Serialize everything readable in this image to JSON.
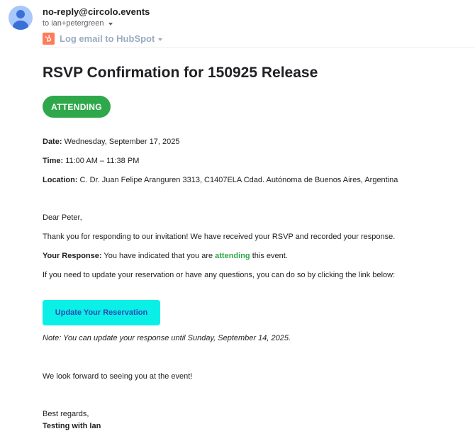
{
  "header": {
    "sender": "no-reply@circolo.events",
    "recipient": "to ian+petergreen",
    "hubspot_label": "Log email to HubSpot"
  },
  "email": {
    "title": "RSVP Confirmation for 150925 Release",
    "status_badge": "ATTENDING",
    "details": {
      "date_label": "Date:",
      "date_value": " Wednesday, September 17, 2025",
      "time_label": "Time:",
      "time_value": " 11:00 AM – 11:38 PM",
      "location_label": "Location:",
      "location_value": " C. Dr. Juan Felipe Aranguren 3313, C1407ELA Cdad. Autónoma de Buenos Aires, Argentina"
    },
    "greeting": "Dear Peter,",
    "thanks": "Thank you for responding to our invitation! We have received your RSVP and recorded your response.",
    "response_label": "Your Response:",
    "response_prefix": " You have indicated that you are ",
    "response_status": "attending",
    "response_suffix": " this event.",
    "update_info": "If you need to update your reservation or have any questions, you can do so by clicking the link below:",
    "cta_label": "Update Your Reservation",
    "note": "Note: You can update your response until Sunday, September 14, 2025.",
    "closing": "We look forward to seeing you at the event!",
    "signoff": "Best regards,",
    "signature": "Testing with Ian"
  },
  "colors": {
    "accent_green": "#2ea84a",
    "cta_background": "#0aefe6",
    "cta_text": "#2b4ab5",
    "hubspot_orange": "#ff7a59"
  }
}
